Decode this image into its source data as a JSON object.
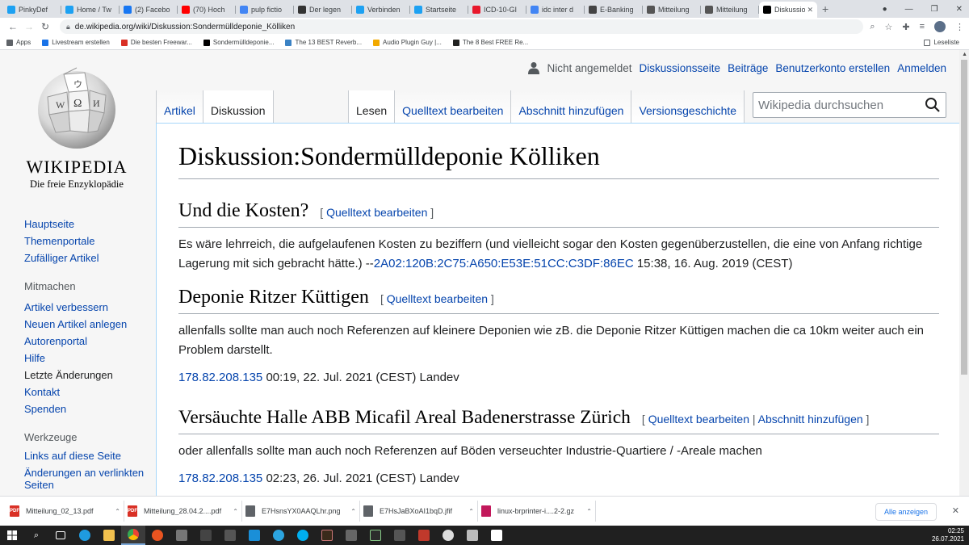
{
  "browser": {
    "tabs": [
      {
        "title": "PinkyDef",
        "icon": "twitter-icon",
        "color": "#1da1f2"
      },
      {
        "title": "Home / Tw",
        "icon": "twitter-icon",
        "color": "#1da1f2"
      },
      {
        "title": "(2) Facebo",
        "icon": "facebook-icon",
        "color": "#1877f2"
      },
      {
        "title": "(70) Hoch",
        "icon": "youtube-icon",
        "color": "#ff0000"
      },
      {
        "title": "pulp fictio",
        "icon": "google-icon",
        "color": "#4285f4"
      },
      {
        "title": "Der legen",
        "icon": "blog-icon",
        "color": "#333333"
      },
      {
        "title": "Verbinden",
        "icon": "twitter-icon",
        "color": "#1da1f2"
      },
      {
        "title": "Startseite",
        "icon": "twitter-icon",
        "color": "#1da1f2"
      },
      {
        "title": "ICD-10-GI",
        "icon": "icd-icon",
        "color": "#e8182c"
      },
      {
        "title": "idc inter d",
        "icon": "google-icon",
        "color": "#4285f4"
      },
      {
        "title": "E-Banking",
        "icon": "bank-icon",
        "color": "#444444"
      },
      {
        "title": "Mitteilung",
        "icon": "globe-icon",
        "color": "#555555"
      },
      {
        "title": "Mitteilung",
        "icon": "globe-icon",
        "color": "#555555"
      },
      {
        "title": "Diskussio",
        "icon": "wikipedia-icon",
        "color": "#000000",
        "active": true
      }
    ],
    "new_tab": "+",
    "url": "de.wikipedia.org/wiki/Diskussion:Sondermülldeponie_Kölliken",
    "bookmarks": [
      {
        "label": "Apps",
        "icon": "apps-grid-icon",
        "color": "#5f6368"
      },
      {
        "label": "Livestream erstellen",
        "icon": "livestream-icon",
        "color": "#1a73e8"
      },
      {
        "label": "Die besten Freewar...",
        "icon": "star-icon",
        "color": "#d93025"
      },
      {
        "label": "Sondermülldeponie...",
        "icon": "wikipedia-icon",
        "color": "#000000"
      },
      {
        "label": "The 13 BEST Reverb...",
        "icon": "audio-icon",
        "color": "#3b82c4"
      },
      {
        "label": "Audio Plugin Guy |...",
        "icon": "plugin-icon",
        "color": "#f2a900"
      },
      {
        "label": "The 8 Best FREE Re...",
        "icon": "music-icon",
        "color": "#222222"
      }
    ],
    "reading_list": "Leseliste"
  },
  "wiki": {
    "wordmark": "Wikipedia",
    "slogan": "Die freie Enzyklopädie",
    "personal": {
      "not_logged_in": "Nicht angemeldet",
      "links": [
        "Diskussionsseite",
        "Beiträge",
        "Benutzerkonto erstellen",
        "Anmelden"
      ]
    },
    "namespace_tabs": [
      "Artikel",
      "Diskussion"
    ],
    "view_tabs": [
      "Lesen",
      "Quelltext bearbeiten",
      "Abschnitt hinzufügen",
      "Versionsgeschichte"
    ],
    "search_placeholder": "Wikipedia durchsuchen",
    "nav": {
      "main": [
        "Hauptseite",
        "Themenportale",
        "Zufälliger Artikel"
      ],
      "mitmachen_heading": "Mitmachen",
      "mitmachen": [
        "Artikel verbessern",
        "Neuen Artikel anlegen",
        "Autorenportal",
        "Hilfe",
        "Letzte Änderungen",
        "Kontakt",
        "Spenden"
      ],
      "werkzeuge_heading": "Werkzeuge",
      "werkzeuge": [
        "Links auf diese Seite",
        "Änderungen an verlinkten Seiten"
      ]
    },
    "title": "Diskussion:Sondermülldeponie Kölliken",
    "edit_label": "Quelltext bearbeiten",
    "add_section_label": "Abschnitt hinzufügen",
    "sections": [
      {
        "heading": "Und die Kosten?",
        "text": "Es wäre lehrreich, die aufgelaufenen Kosten zu beziffern (und vielleicht sogar den Kosten gegenüberzustellen, die eine von Anfang richtige Lagerung mit sich gebracht hätte.) --",
        "user": "2A02:120B:2C75:A650:E53E:51CC:C3DF:86EC",
        "timestamp": " 15:38, 16. Aug. 2019 (CEST)"
      },
      {
        "heading": "Deponie Ritzer Küttigen",
        "text": "allenfalls sollte man auch noch Referenzen auf kleinere Deponien wie zB. die Deponie Ritzer Küttigen machen die ca 10km weiter auch ein Problem darstellt.",
        "user": "178.82.208.135",
        "timestamp": " 00:19, 22. Jul. 2021 (CEST) Landev"
      },
      {
        "heading": "Versäuchte Halle ABB Micafil Areal Badenerstrasse Zürich",
        "text": "oder allenfalls sollte man auch noch Referenzen auf Böden verseuchter Industrie-Quartiere / -Areale machen",
        "user": "178.82.208.135",
        "timestamp": " 02:23, 26. Jul. 2021 (CEST) Landev"
      }
    ]
  },
  "downloads": {
    "items": [
      {
        "name": "Mitteilung_02_13.pdf",
        "icon": "pdf-icon",
        "color": "#d93025"
      },
      {
        "name": "Mitteilung_28.04.2....pdf",
        "icon": "pdf-icon",
        "color": "#d93025"
      },
      {
        "name": "E7HsnsYX0AAQLhr.png",
        "icon": "image-file-icon",
        "color": "#5f6368"
      },
      {
        "name": "E7HsJaBXoAI1bqD.jfif",
        "icon": "image-file-icon",
        "color": "#5f6368"
      },
      {
        "name": "linux-brprinter-i....2-2.gz",
        "icon": "archive-icon",
        "color": "#c2185b"
      }
    ],
    "show_all": "Alle anzeigen"
  },
  "taskbar": {
    "time": "02:25",
    "date": "26.07.2021"
  }
}
